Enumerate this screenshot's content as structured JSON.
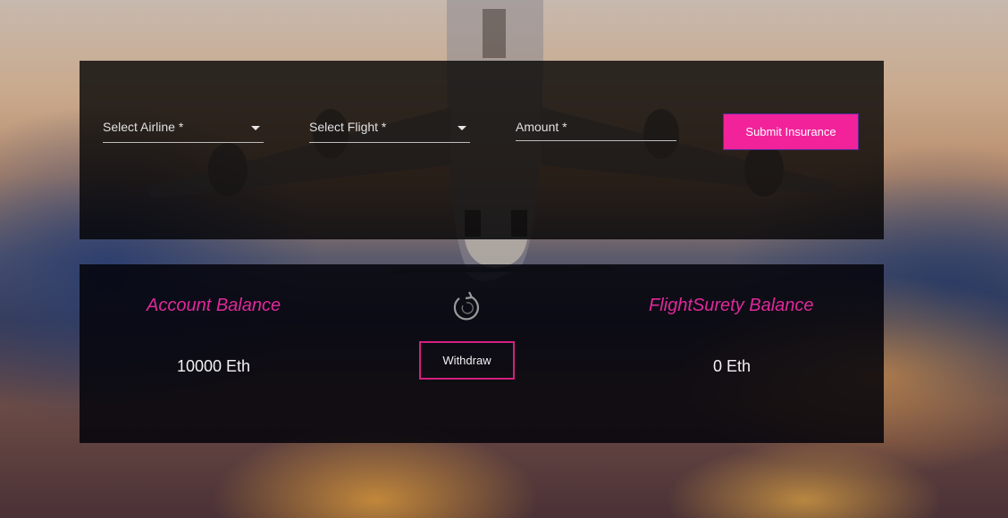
{
  "form": {
    "airline_label": "Select Airline *",
    "flight_label": "Select Flight *",
    "amount_label": "Amount *",
    "amount_value": "",
    "submit_label": "Submit Insurance"
  },
  "balances": {
    "account_title": "Account Balance",
    "account_value": "10000 Eth",
    "flightsurety_title": "FlightSurety Balance",
    "flightsurety_value": "0 Eth",
    "withdraw_label": "Withdraw",
    "refresh_icon": "refresh-icon"
  },
  "colors": {
    "accent": "#f2239a",
    "title_pink": "#e0289a",
    "withdraw_border": "#d4207f"
  }
}
